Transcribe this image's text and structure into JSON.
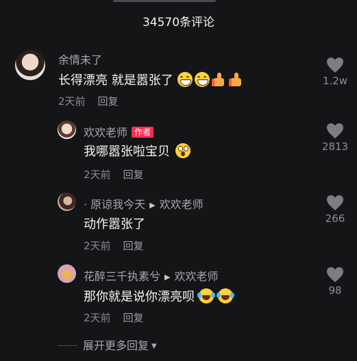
{
  "header": {
    "title": "34570条评论"
  },
  "comments": [
    {
      "username": "余情未了",
      "text": "长得漂亮 就是嚣张了",
      "time": "2天前",
      "reply_label": "回复",
      "likes": "1.2w",
      "emojis": [
        "grin",
        "grin",
        "thumbs-up",
        "thumbs-up"
      ]
    }
  ],
  "replies": [
    {
      "username": "欢欢老师",
      "badge": "作者",
      "text": "我哪嚣张啦宝贝",
      "time": "2天前",
      "reply_label": "回复",
      "likes": "2813",
      "emojis": [
        "shocked"
      ]
    },
    {
      "username": "· 原谅我今天",
      "reply_to": "欢欢老师",
      "text": "动作嚣张了",
      "time": "2天前",
      "reply_label": "回复",
      "likes": "266"
    },
    {
      "username": "花醉三千执素兮",
      "reply_to": "欢欢老师",
      "text": "那你就是说你漂亮呗",
      "time": "2天前",
      "reply_label": "回复",
      "likes": "98",
      "emojis": [
        "laughing-tears",
        "laughing-tears"
      ]
    }
  ],
  "footer": {
    "expand_label": "展开更多回复"
  },
  "colors": {
    "background": "#141517",
    "badge": "#fe2c55",
    "muted_text": "#8a8b90"
  }
}
